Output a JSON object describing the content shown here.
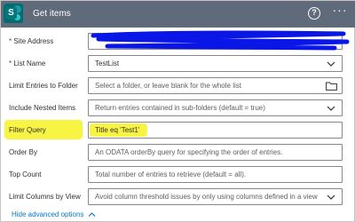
{
  "header": {
    "title": "Get items",
    "app_icon_letter": "S",
    "help_label": "?",
    "more_label": "···"
  },
  "fields": {
    "site_address": {
      "label": "Site Address",
      "required_mark": "*",
      "value": ""
    },
    "list_name": {
      "label": "List Name",
      "required_mark": "*",
      "value": "TestList"
    },
    "limit_folder": {
      "label": "Limit Entries to Folder",
      "placeholder": "Select a folder, or leave blank for the whole list"
    },
    "nested_items": {
      "label": "Include Nested Items",
      "placeholder": "Return entries contained in sub-folders (default = true)"
    },
    "filter_query": {
      "label": "Filter Query",
      "value": "Title eq 'Test1'"
    },
    "order_by": {
      "label": "Order By",
      "placeholder": "An ODATA orderBy query for specifying the order of entries."
    },
    "top_count": {
      "label": "Top Count",
      "placeholder": "Total number of entries to retrieve (default = all)."
    },
    "limit_columns": {
      "label": "Limit Columns by View",
      "placeholder": "Avoid column threshold issues by only using columns defined in a view"
    }
  },
  "footer": {
    "advanced_label": "Hide advanced options"
  },
  "colors": {
    "header_bg": "#5f6a7b",
    "accent": "#0078d4",
    "highlight": "#f7f223",
    "redaction": "#0a16e6"
  },
  "icons": {
    "dropdown": "chevron-down-icon",
    "folder": "folder-icon",
    "advanced": "chevron-up-icon"
  }
}
